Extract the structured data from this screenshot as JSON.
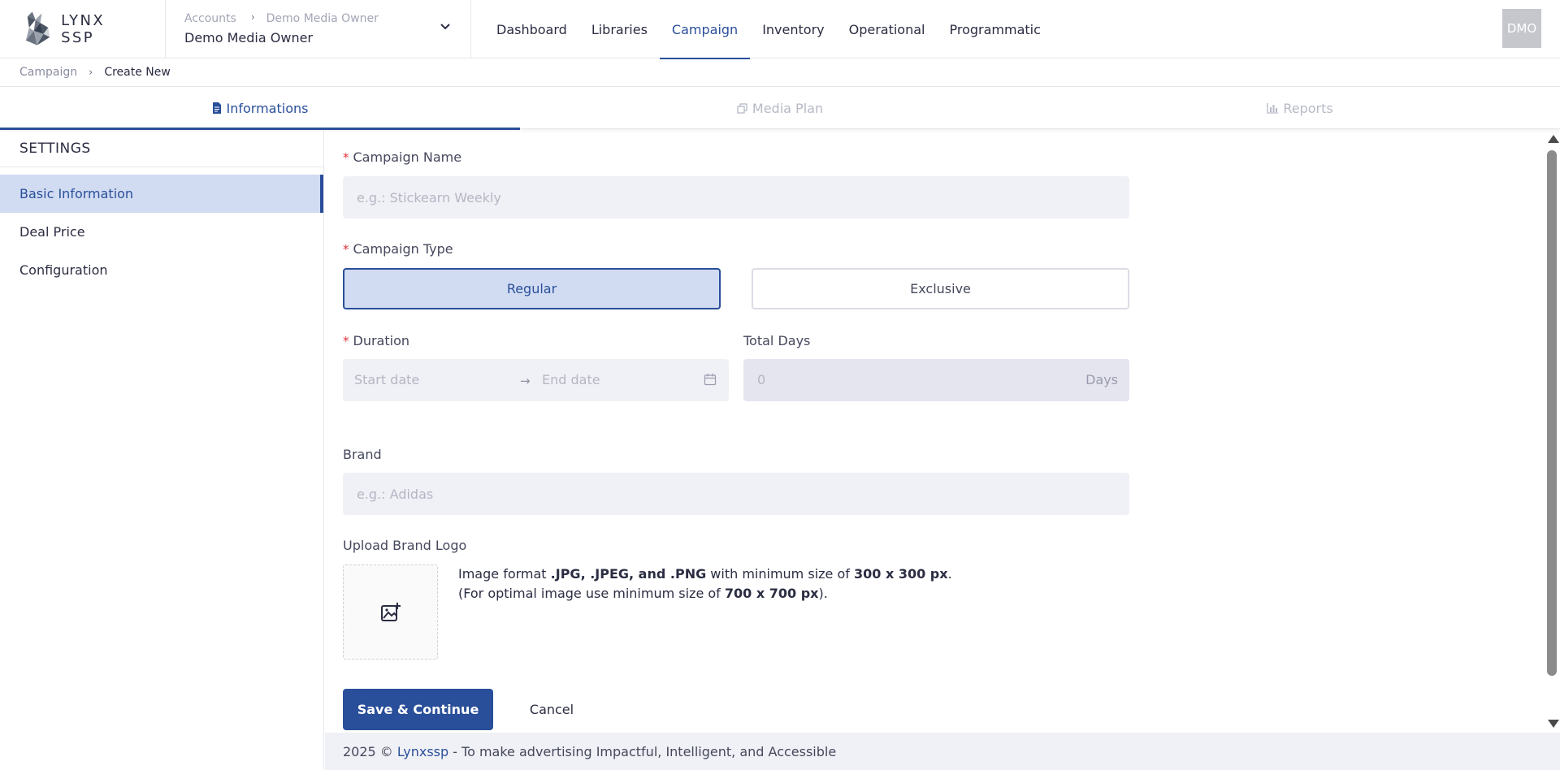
{
  "app": {
    "name": "LYNX SSP"
  },
  "account": {
    "breadcrumb": [
      "Accounts",
      "Demo Media Owner"
    ],
    "current": "Demo Media Owner"
  },
  "nav": {
    "items": [
      {
        "label": "Dashboard",
        "active": false
      },
      {
        "label": "Libraries",
        "active": false
      },
      {
        "label": "Campaign",
        "active": true
      },
      {
        "label": "Inventory",
        "active": false
      },
      {
        "label": "Operational",
        "active": false
      },
      {
        "label": "Programmatic",
        "active": false
      }
    ]
  },
  "user": {
    "initials": "DMO"
  },
  "breadcrumb": {
    "parent": "Campaign",
    "current": "Create New"
  },
  "tabs": [
    {
      "label": "Informations",
      "icon": "document-icon",
      "active": true
    },
    {
      "label": "Media Plan",
      "icon": "copy-icon",
      "active": false
    },
    {
      "label": "Reports",
      "icon": "bar-chart-icon",
      "active": false
    }
  ],
  "sidebar": {
    "title": "SETTINGS",
    "items": [
      {
        "label": "Basic Information",
        "active": true
      },
      {
        "label": "Deal Price",
        "active": false
      },
      {
        "label": "Configuration",
        "active": false
      }
    ]
  },
  "form": {
    "campaign_name": {
      "label": "Campaign Name",
      "required": true,
      "placeholder": "e.g.: Stickearn Weekly",
      "value": ""
    },
    "campaign_type": {
      "label": "Campaign Type",
      "required": true,
      "options": [
        "Regular",
        "Exclusive"
      ],
      "selected": "Regular"
    },
    "duration": {
      "label": "Duration",
      "required": true,
      "start_placeholder": "Start date",
      "end_placeholder": "End date",
      "arrow": "→"
    },
    "total_days": {
      "label": "Total Days",
      "value": "0",
      "unit": "Days"
    },
    "brand": {
      "label": "Brand",
      "placeholder": "e.g.: Adidas",
      "value": ""
    },
    "upload": {
      "label": "Upload Brand Logo",
      "line1_pre": "Image format ",
      "line1_formats": ".JPG, .JPEG, and .PNG",
      "line1_mid": " with minimum size of ",
      "line1_size": "300 x 300 px",
      "line1_end": ".",
      "line2_pre": "(For optimal image use minimum size of ",
      "line2_size": "700 x 700 px",
      "line2_end": ")."
    },
    "save_label": "Save & Continue",
    "cancel_label": "Cancel"
  },
  "footer": {
    "year": "2025 ©",
    "brand": "Lynxssp",
    "tagline": "- To make advertising Impactful, Intelligent, and Accessible"
  },
  "colors": {
    "primary": "#2a4f9a",
    "selected_bg": "#d1dcf2",
    "input_bg": "#f0f1f6",
    "required": "#e0323c"
  }
}
